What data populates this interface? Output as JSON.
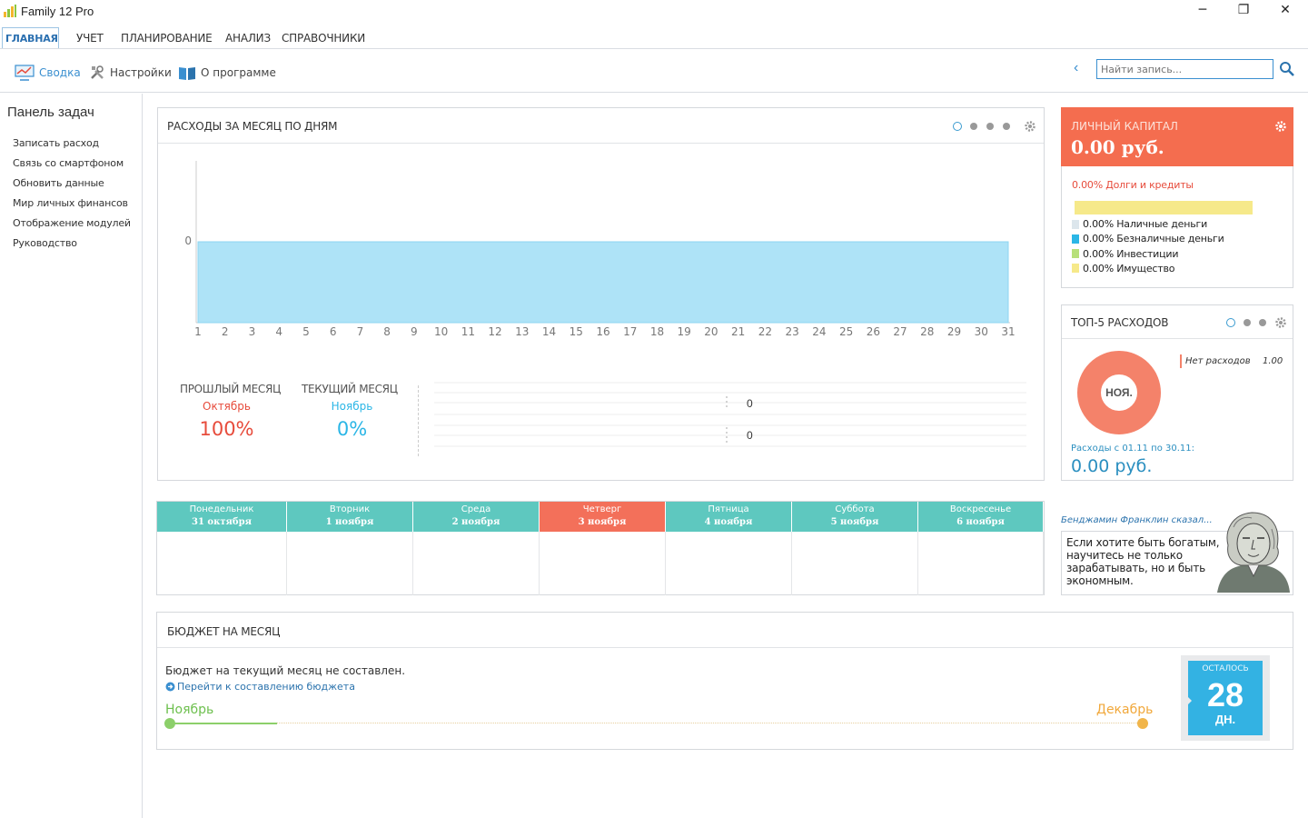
{
  "window": {
    "title": "Family 12 Pro",
    "minimize": "─",
    "maximize": "❐",
    "close": "✕"
  },
  "menu": {
    "tabs": [
      "ГЛАВНАЯ",
      "УЧЕТ",
      "ПЛАНИРОВАНИЕ",
      "АНАЛИЗ",
      "СПРАВОЧНИКИ"
    ]
  },
  "ribbon": {
    "summary": "Сводка",
    "settings": "Настройки",
    "about": "О программе"
  },
  "search": {
    "placeholder": "Найти запись..."
  },
  "task_panel": {
    "title": "Панель задач",
    "items": [
      "Записать расход",
      "Связь со смартфоном",
      "Обновить данные",
      "Мир личных финансов",
      "Отображение модулей",
      "Руководство"
    ]
  },
  "expenses_panel": {
    "title": "РАСХОДЫ ЗА МЕСЯЦ ПО ДНЯМ",
    "prev": {
      "title": "ПРОШЛЫЙ МЕСЯЦ",
      "month": "Октябрь",
      "percent": "100%"
    },
    "curr": {
      "title": "ТЕКУЩИЙ МЕСЯЦ",
      "month": "Ноябрь",
      "percent": "0%"
    },
    "bar_values": [
      "0",
      "0"
    ]
  },
  "chart_data": {
    "type": "area",
    "x": [
      1,
      2,
      3,
      4,
      5,
      6,
      7,
      8,
      9,
      10,
      11,
      12,
      13,
      14,
      15,
      16,
      17,
      18,
      19,
      20,
      21,
      22,
      23,
      24,
      25,
      26,
      27,
      28,
      29,
      30,
      31
    ],
    "y_tick_labels": [
      "0"
    ],
    "series": [
      {
        "values": [
          0,
          0,
          0,
          0,
          0,
          0,
          0,
          0,
          0,
          0,
          0,
          0,
          0,
          0,
          0,
          0,
          0,
          0,
          0,
          0,
          0,
          0,
          0,
          0,
          0,
          0,
          0,
          0,
          0,
          0,
          0
        ]
      }
    ],
    "color": "#aee3f7"
  },
  "week": [
    {
      "day": "Понедельник",
      "date": "31 октября",
      "today": false
    },
    {
      "day": "Вторник",
      "date": "1 ноября",
      "today": false
    },
    {
      "day": "Среда",
      "date": "2 ноября",
      "today": false
    },
    {
      "day": "Четверг",
      "date": "3 ноября",
      "today": true
    },
    {
      "day": "Пятница",
      "date": "4 ноября",
      "today": false
    },
    {
      "day": "Суббота",
      "date": "5 ноября",
      "today": false
    },
    {
      "day": "Воскресенье",
      "date": "6 ноября",
      "today": false
    }
  ],
  "budget": {
    "title": "БЮДЖЕТ НА МЕСЯЦ",
    "message": "Бюджет на текущий месяц не составлен.",
    "link": "Перейти к составлению бюджета",
    "start": "Ноябрь",
    "end": "Декабрь",
    "remaining_label": "ОСТАЛОСЬ",
    "remaining_days": "28",
    "remaining_unit": "ДН.",
    "progress_fraction": 0.11
  },
  "capital": {
    "title": "ЛИЧНЫЙ КАПИТАЛ",
    "amount": "0.00 руб.",
    "debts": "0.00% Долги и кредиты",
    "legend": [
      {
        "label": "0.00% Наличные деньги",
        "color": "#dce6ec"
      },
      {
        "label": "0.00% Безналичные деньги",
        "color": "#2bb6e6"
      },
      {
        "label": "0.00% Инвестиции",
        "color": "#b7e07a"
      },
      {
        "label": "0.00% Имущество",
        "color": "#f6e98a"
      }
    ]
  },
  "top5": {
    "title": "ТОП-5 РАСХОДОВ",
    "donut_label": "НОЯ.",
    "legend_label": "Нет расходов",
    "legend_value": "1.00",
    "period": "Расходы с 01.11 по 30.11:",
    "amount": "0.00 руб.",
    "donut_color": "#f4826a"
  },
  "quote": {
    "author": "Бенджамин Франклин сказал...",
    "text": "Если хотите быть богатым, научитесь не только зарабатывать, но и быть экономным."
  },
  "colors": {
    "accent": "#3a8fd0",
    "teal": "#5ec8bf",
    "orange": "#f46d4f"
  }
}
